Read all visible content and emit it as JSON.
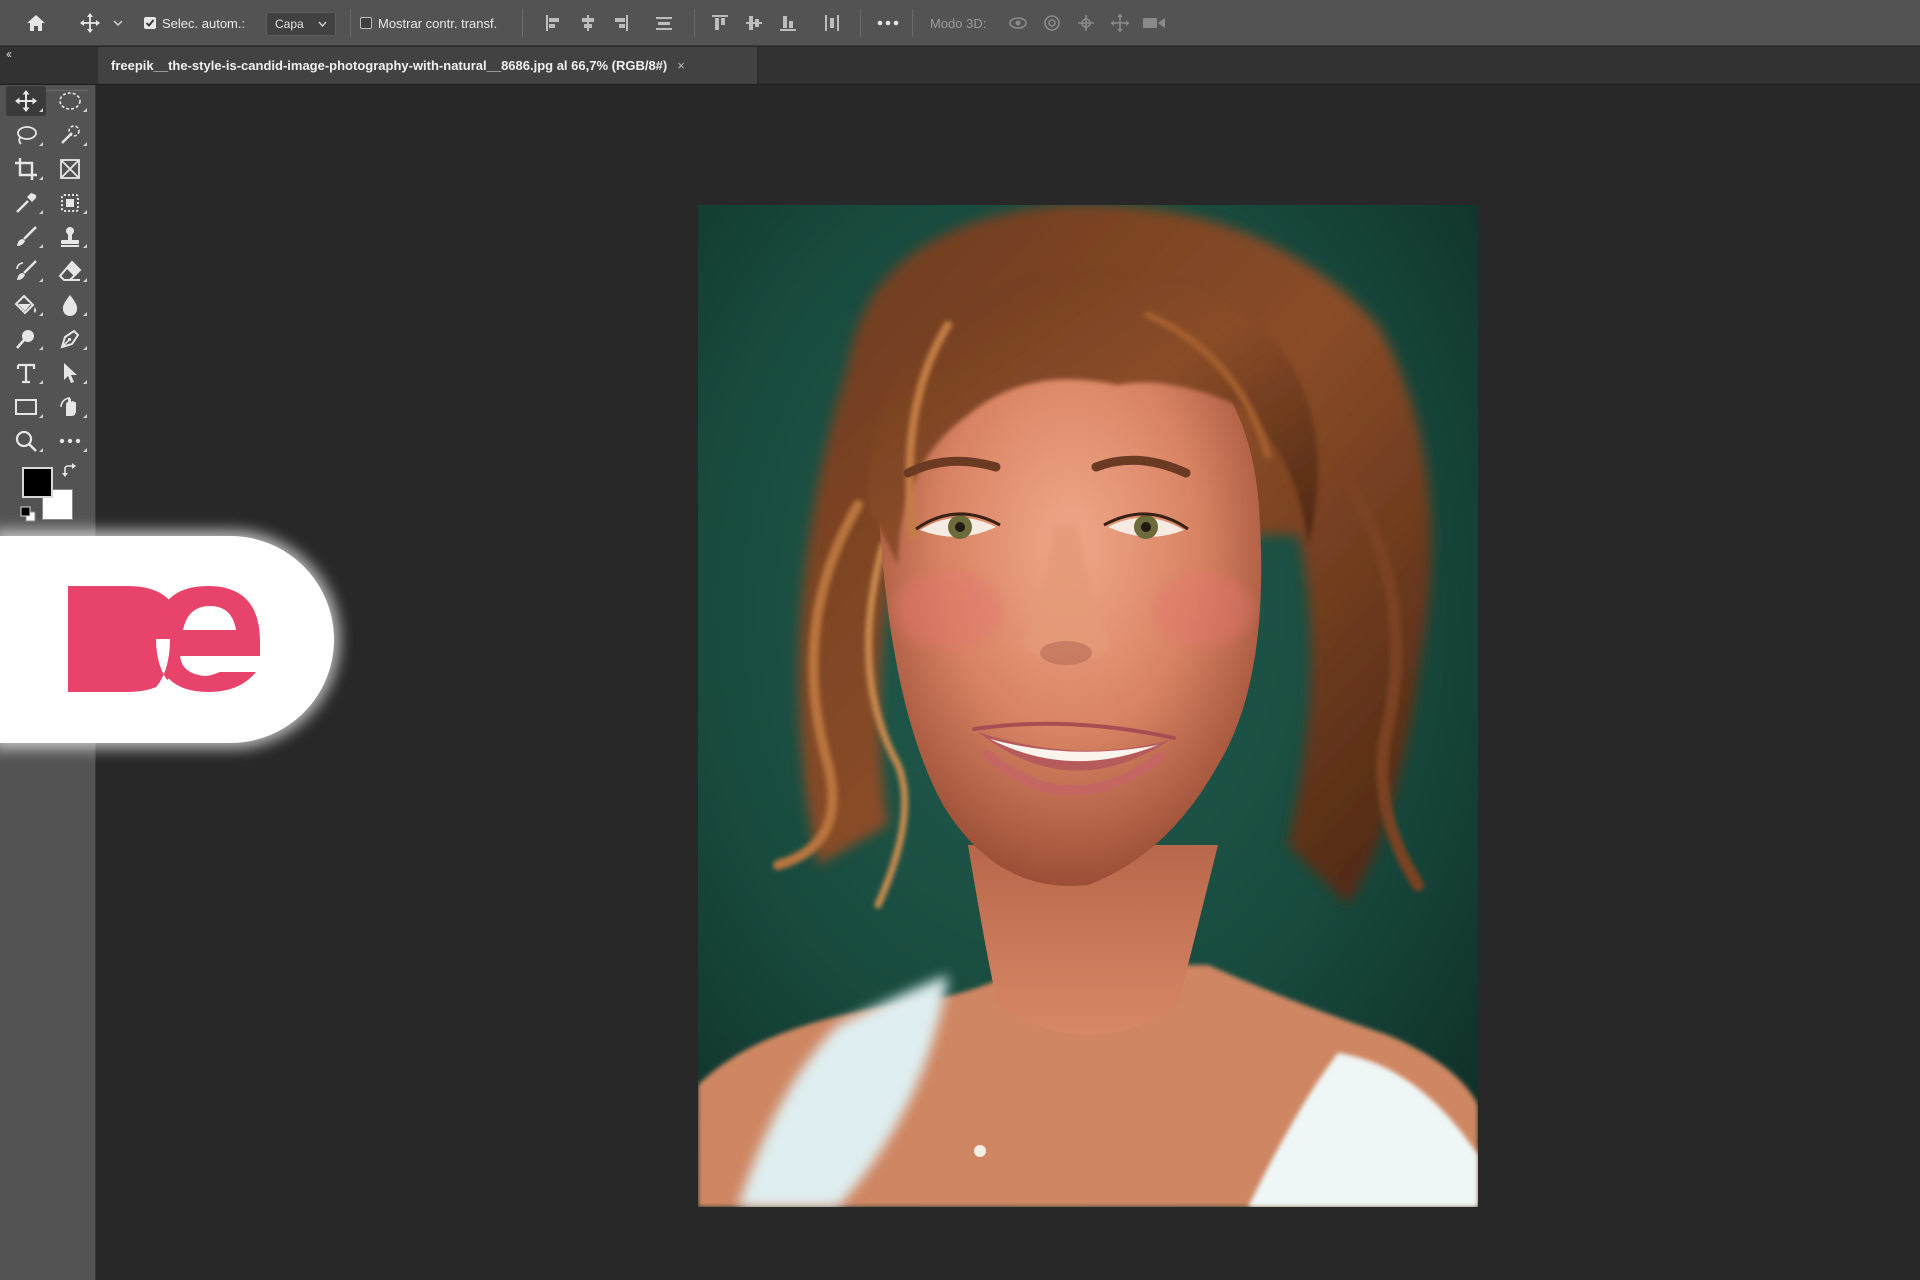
{
  "options_bar": {
    "home_icon": "home-icon",
    "move_tool_icon": "move-icon",
    "auto_select_label": "Selec. autom.:",
    "auto_select_checked": true,
    "layer_select_value": "Capa",
    "show_transform_label": "Mostrar contr. transf.",
    "show_transform_checked": false,
    "more_icon": "more-horizontal-icon",
    "mode3d_label": "Modo 3D:"
  },
  "tab_bar": {
    "collapse_glyph": "‹‹",
    "document_title": "freepik__the-style-is-candid-image-photography-with-natural__8686.jpg al 66,7% (RGB/8#)",
    "close_glyph": "×"
  },
  "colors": {
    "foreground": "#000000",
    "background": "#ffffff",
    "brand_accent": "#e8436a"
  },
  "toolbar": {
    "tools": [
      "move-icon",
      "marquee-ellipse-icon",
      "lasso-icon",
      "quick-selection-icon",
      "crop-icon",
      "frame-icon",
      "eyedropper-icon",
      "spot-healing-icon",
      "brush-icon",
      "clone-stamp-icon",
      "history-brush-icon",
      "eraser-icon",
      "paint-bucket-icon",
      "blur-drop-icon",
      "dodge-icon",
      "pen-icon",
      "type-icon",
      "path-selection-icon",
      "rectangle-icon",
      "hand-rotate-icon",
      "zoom-icon",
      "more-tools-icon"
    ]
  },
  "canvas": {
    "content": "portrait photo of a smiling woman with wavy brown hair against a dark green background"
  },
  "watermark": {
    "logo_text": "De"
  }
}
